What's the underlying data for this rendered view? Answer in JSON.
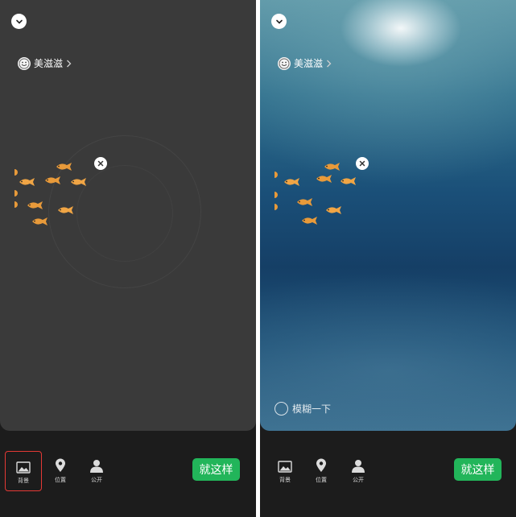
{
  "left_panel": {
    "user_name": "美滋滋",
    "toolbar": {
      "background_label": "背景",
      "location_label": "位置",
      "visibility_label": "公开",
      "confirm_label": "就这样"
    }
  },
  "right_panel": {
    "user_name": "美滋滋",
    "blur_label": "模糊一下",
    "toolbar": {
      "background_label": "背景",
      "location_label": "位置",
      "visibility_label": "公开",
      "confirm_label": "就这样"
    }
  },
  "colors": {
    "confirm_green": "#22b55a",
    "highlight_red": "#e53935",
    "fish_orange": "#e89a3a"
  },
  "icons": [
    "chevron-down-icon",
    "smiley-avatar-icon",
    "chevron-right-icon",
    "goldfish-sticker",
    "close-icon",
    "image-icon",
    "location-pin-icon",
    "person-icon"
  ]
}
